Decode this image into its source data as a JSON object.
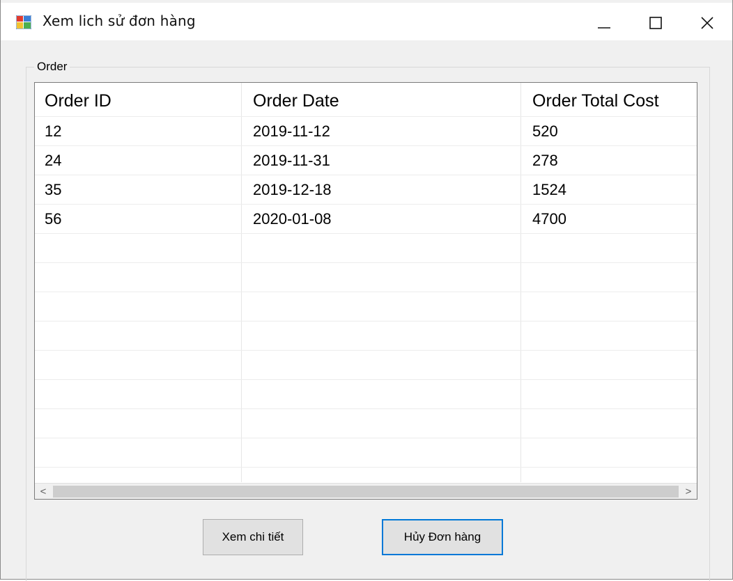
{
  "window": {
    "title": "Xem lich sử đơn hàng",
    "icon": "app-window-icon",
    "controls": [
      "minimize-icon",
      "maximize-icon",
      "close-icon"
    ]
  },
  "group": {
    "label": "Order"
  },
  "grid": {
    "columns": [
      "Order ID",
      "Order Date",
      "Order Total Cost"
    ],
    "rows": [
      [
        "12",
        "2019-11-12",
        "520"
      ],
      [
        "24",
        "2019-11-31",
        "278"
      ],
      [
        "35",
        "2019-12-18",
        "1524"
      ],
      [
        "56",
        "2020-01-08",
        "4700"
      ]
    ],
    "scroll_left": "<",
    "scroll_right": ">"
  },
  "buttons": {
    "detail": "Xem chi tiết",
    "cancel_order": "Hủy Đơn hàng"
  },
  "colors": {
    "focus_border": "#0078d7",
    "button_bg": "#e1e1e1",
    "window_bg": "#f0f0f0"
  }
}
